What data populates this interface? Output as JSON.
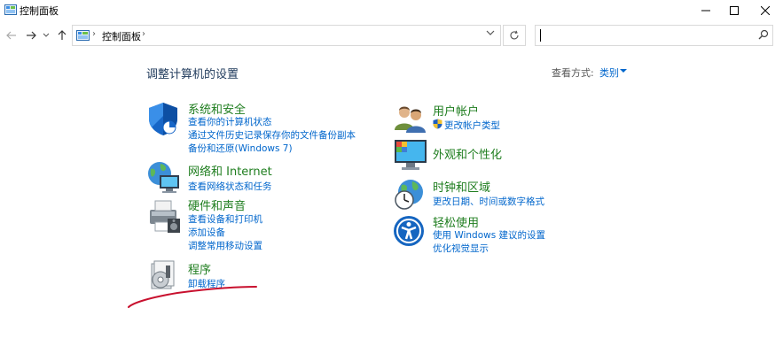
{
  "window": {
    "title": "控制面板"
  },
  "address": {
    "path": "控制面板",
    "separator": "›"
  },
  "search": {
    "placeholder": ""
  },
  "header": {
    "title": "调整计算机的设置",
    "view_by_label": "查看方式:",
    "view_by_value": "类别"
  },
  "categories": {
    "system": {
      "title": "系统和安全",
      "links": [
        "查看你的计算机状态",
        "通过文件历史记录保存你的文件备份副本",
        "备份和还原(Windows 7)"
      ]
    },
    "network": {
      "title": "网络和 Internet",
      "links": [
        "查看网络状态和任务"
      ]
    },
    "hardware": {
      "title": "硬件和声音",
      "links": [
        "查看设备和打印机",
        "添加设备",
        "调整常用移动设置"
      ]
    },
    "programs": {
      "title": "程序",
      "links": [
        "卸载程序"
      ]
    },
    "users": {
      "title": "用户帐户",
      "links": [
        "更改帐户类型"
      ]
    },
    "appearance": {
      "title": "外观和个性化",
      "links": []
    },
    "clock": {
      "title": "时钟和区域",
      "links": [
        "更改日期、时间或数字格式"
      ]
    },
    "ease": {
      "title": "轻松使用",
      "links": [
        "使用 Windows 建议的设置",
        "优化视觉显示"
      ]
    }
  },
  "colors": {
    "category_title": "#1e7d1e",
    "link": "#0066cc",
    "header_title": "#1e395b",
    "annotation": "#c8102e"
  }
}
